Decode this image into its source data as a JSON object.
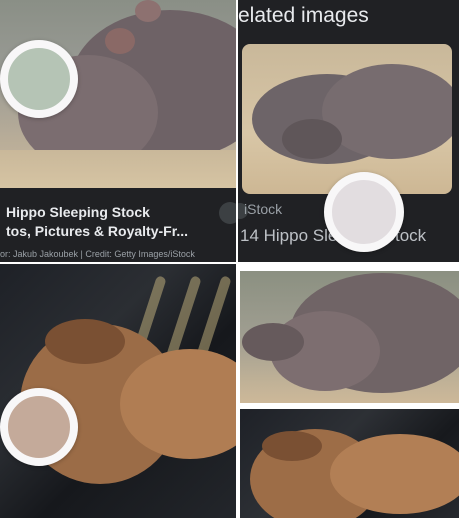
{
  "tiles": {
    "hippo_result": {
      "title_line1": "Hippo Sleeping Stock",
      "title_line2": "tos, Pictures & Royalty-Fr...",
      "credit": "or: Jakub Jakoubek | Credit: Getty Images/iStock"
    },
    "related": {
      "heading": "elated images",
      "source": "iStock",
      "result_title": "14 Hippo Sleeping Stock"
    }
  },
  "swatches": [
    {
      "name": "sage",
      "color": "#b5c4b5"
    },
    {
      "name": "light-gray",
      "color": "#e2dde0"
    },
    {
      "name": "tan",
      "color": "#c4aa9a"
    }
  ],
  "colors": {
    "panel_bg": "#202124",
    "title_text": "#e8eaed",
    "secondary_text": "#9aa0a6"
  }
}
